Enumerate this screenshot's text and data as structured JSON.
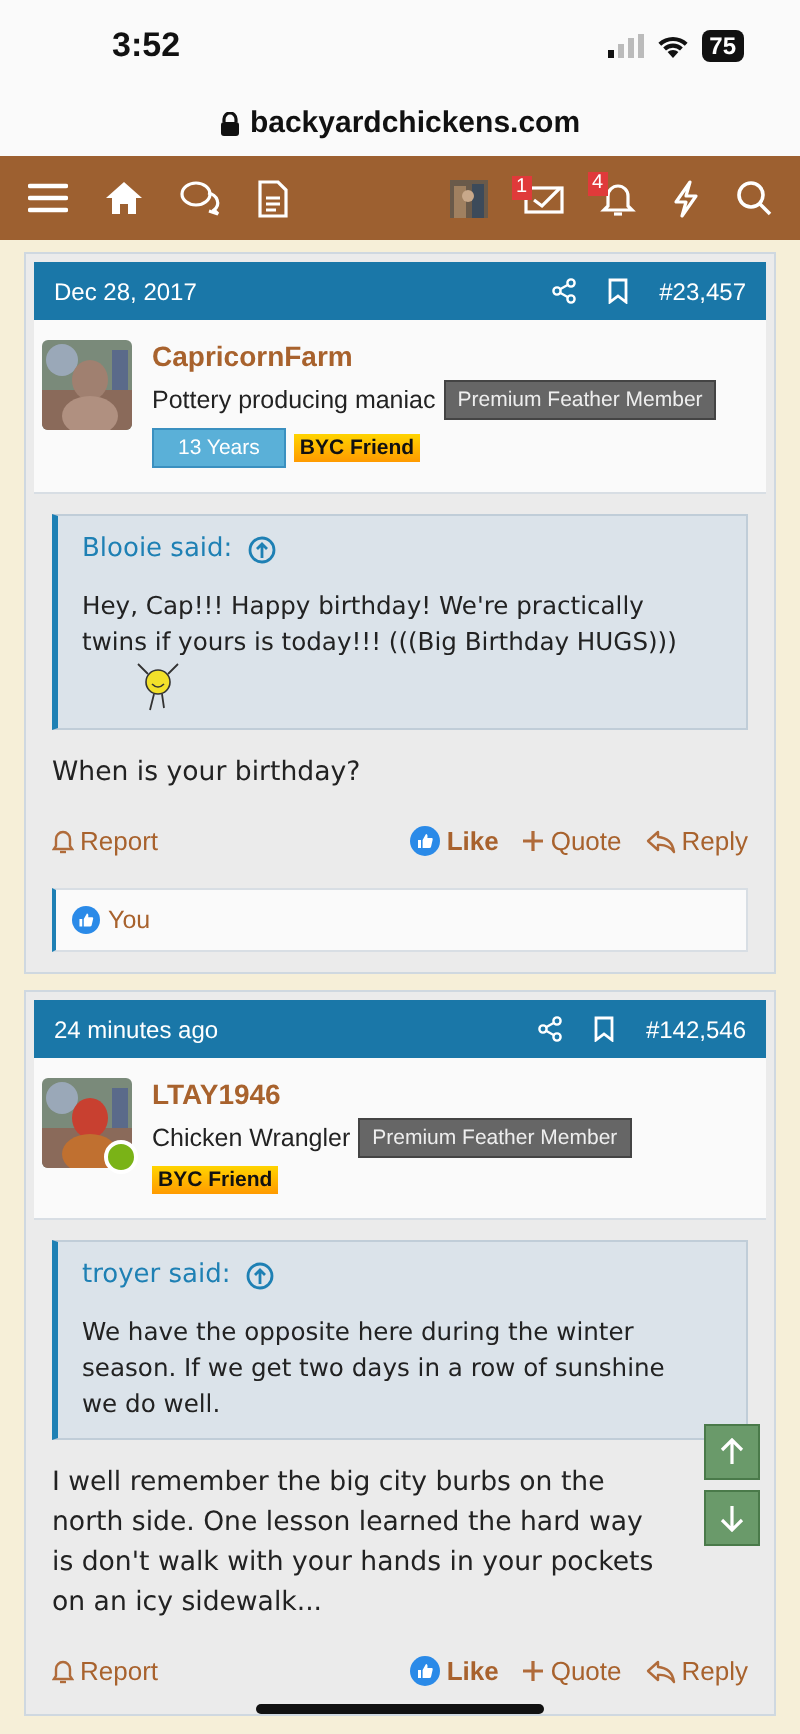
{
  "status_bar": {
    "time": "3:52",
    "battery": "75"
  },
  "browser": {
    "url": "backyardchickens.com"
  },
  "nav": {
    "messages_count": "1",
    "alerts_count": "4"
  },
  "posts": [
    {
      "date": "Dec 28, 2017",
      "number": "#23,457",
      "user": {
        "name": "CapricornFarm",
        "title": "Pottery producing maniac",
        "badges": [
          {
            "kind": "member",
            "label": "Premium Feather Member"
          },
          {
            "kind": "years",
            "label": "13 Years"
          },
          {
            "kind": "friend",
            "label": "BYC Friend"
          }
        ]
      },
      "quote": {
        "author": "Blooie said:",
        "text": "Hey, Cap!!! Happy birthday! We're practically twins if yours is today!!! (((Big Birthday HUGS)))",
        "smiley": true
      },
      "text": "When is your birthday?",
      "actions": {
        "report": "Report",
        "like": "Like",
        "liked": true,
        "quote": "Quote",
        "reply": "Reply"
      },
      "likes": "You"
    },
    {
      "date": "24 minutes ago",
      "number": "#142,546",
      "user": {
        "name": "LTAY1946",
        "title": "Chicken Wrangler",
        "online": true,
        "badges": [
          {
            "kind": "member",
            "label": "Premium Feather Member"
          },
          {
            "kind": "friend",
            "label": "BYC Friend"
          }
        ]
      },
      "quote": {
        "author": "troyer said:",
        "text": "We have the opposite here during the winter season. If we get two days in a row of sunshine we do well."
      },
      "text": "I well remember the big city burbs on the north side. One lesson learned the hard way is don't walk with your hands in your pockets on an icy sidewalk...",
      "actions": {
        "report": "Report",
        "like": "Like",
        "liked": true,
        "quote": "Quote",
        "reply": "Reply"
      }
    }
  ]
}
